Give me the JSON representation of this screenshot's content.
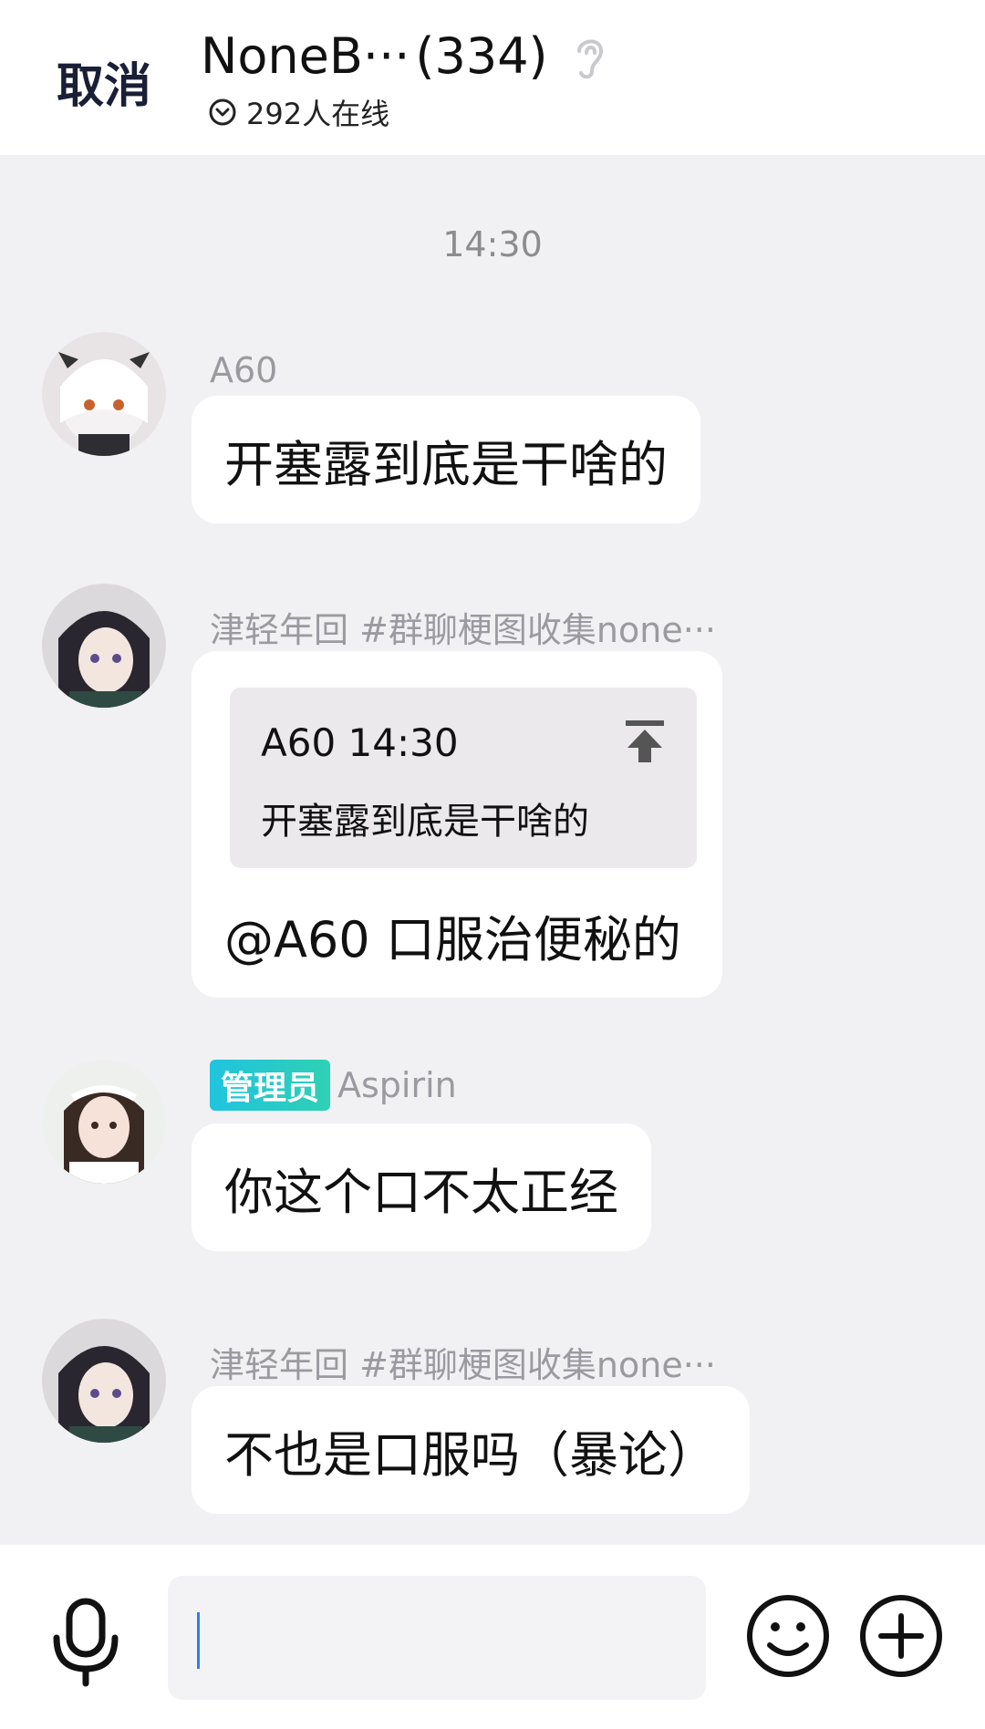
{
  "header": {
    "cancel_label": "取消",
    "group_name": "NoneB···",
    "member_count": "(334)",
    "online_text": "292人在线",
    "icons": {
      "ear": "ear-icon",
      "online": "chevron-circle-icon"
    }
  },
  "chat": {
    "timestamp": "14:30",
    "messages": [
      {
        "sender": "A60",
        "text": "开塞露到底是干啥的"
      },
      {
        "sender": "津轻年回 #群聊梗图收集none···",
        "quote": {
          "header": "A60 14:30",
          "text": "开塞露到底是干啥的"
        },
        "text": "@A60 口服治便秘的"
      },
      {
        "badge": "管理员",
        "sender": "Aspirin",
        "text": "你这个口不太正经"
      },
      {
        "sender": "津轻年回 #群聊梗图收集none···",
        "text": "不也是口服吗（暴论）"
      }
    ]
  },
  "input_bar": {
    "icons": {
      "voice": "microphone-icon",
      "emoji": "smiley-icon",
      "more": "plus-circle-icon"
    },
    "accent_color": "#2a7ff0"
  }
}
